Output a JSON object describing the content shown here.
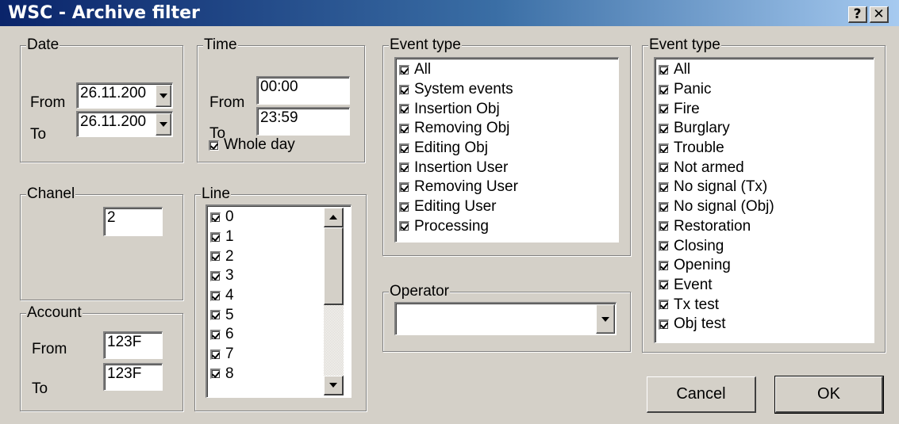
{
  "window": {
    "title": "WSC - Archive filter",
    "help_label": "?",
    "close_label": "✕"
  },
  "date": {
    "legend": "Date",
    "from_label": "From",
    "to_label": "To",
    "from_value": "26.11.200",
    "to_value": "26.11.200"
  },
  "time": {
    "legend": "Time",
    "from_label": "From",
    "to_label": "To",
    "from_value": "00:00",
    "to_value": "23:59",
    "whole_day_label": "Whole day"
  },
  "chanel": {
    "legend": "Chanel",
    "value": "2"
  },
  "line": {
    "legend": "Line",
    "items": [
      "0",
      "1",
      "2",
      "3",
      "4",
      "5",
      "6",
      "7",
      "8"
    ]
  },
  "account": {
    "legend": "Account",
    "from_label": "From",
    "to_label": "To",
    "from_value": "123F",
    "to_value": "123F"
  },
  "event_type_1": {
    "legend": "Event type",
    "items": [
      "All",
      "System events",
      "Insertion Obj",
      "Removing Obj",
      "Editing Obj",
      "Insertion User",
      "Removing User",
      "Editing User",
      "Processing"
    ]
  },
  "operator": {
    "legend": "Operator",
    "value": ""
  },
  "event_type_2": {
    "legend": "Event type",
    "items": [
      "All",
      "Panic",
      "Fire",
      "Burglary",
      "Trouble",
      "Not armed",
      "No signal (Tx)",
      "No signal (Obj)",
      "Restoration",
      "Closing",
      "Opening",
      "Event",
      "Tx test",
      "Obj test"
    ]
  },
  "buttons": {
    "cancel": "Cancel",
    "ok": "OK"
  },
  "colors": {
    "titlebar_start": "#0a246a",
    "titlebar_end": "#a6caf0",
    "face": "#d4d0c8"
  }
}
